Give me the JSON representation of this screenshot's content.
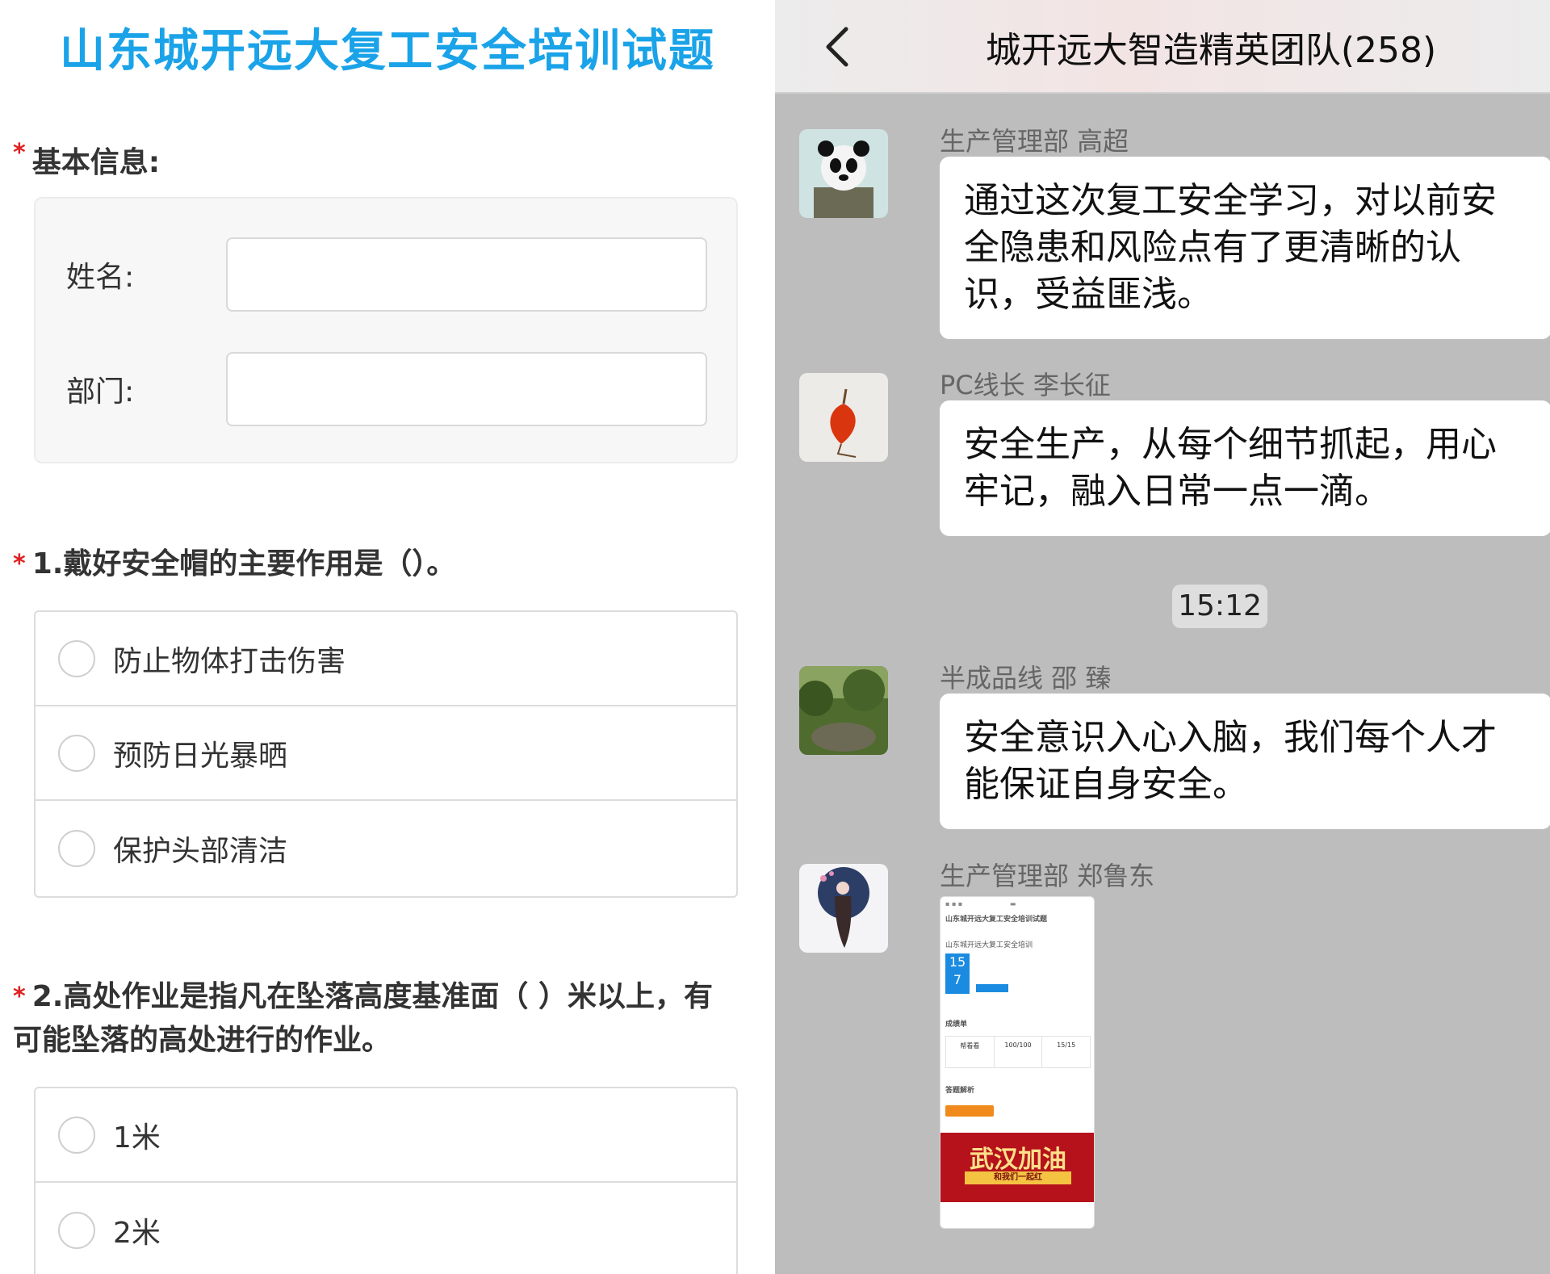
{
  "quiz": {
    "title": "山东城开远大复工安全培训试题",
    "basic_info": {
      "required_mark": "*",
      "label": "基本信息:",
      "name_label": "姓名:",
      "name_value": "",
      "dept_label": "部门:",
      "dept_value": ""
    },
    "questions": [
      {
        "required_mark": "*",
        "text": "1.戴好安全帽的主要作用是（）。",
        "options": [
          "防止物体打击伤害",
          "预防日光暴晒",
          "保护头部清洁"
        ]
      },
      {
        "required_mark": "*",
        "text": "2.高处作业是指凡在坠落高度基准面（ ）米以上，有可能坠落的高处进行的作业。",
        "options": [
          "1米",
          "2米"
        ]
      }
    ]
  },
  "chat": {
    "title": "城开远大智造精英团队(258)",
    "time_divider": "15:12",
    "messages": [
      {
        "sender": "生产管理部  高超",
        "text": "通过这次复工安全学习，对以前安全隐患和风险点有了更清晰的认识，受益匪浅。",
        "avatar": "panda-avatar"
      },
      {
        "sender": "PC线长  李长征",
        "text": "安全生产，从每个细节抓起，用心牢记，融入日常一点一滴。",
        "avatar": "lantern-flower-avatar"
      },
      {
        "sender": "半成品线  邵 臻",
        "text": "安全意识入心入脑，我们每个人才能保证自身安全。",
        "avatar": "forest-avatar"
      },
      {
        "sender": "生产管理部  郑鲁东",
        "avatar": "painting-avatar"
      }
    ],
    "thumbnail": {
      "title": "山东城开远大复工安全培训试题",
      "heading": "山东城开远大复工安全培训",
      "score_day": "15",
      "score_month": "7",
      "row_label": "成绩单",
      "cells": [
        "帮看看",
        "100/100",
        "15/15"
      ],
      "analysis_label": "答题解析",
      "banner_big": "武汉加油",
      "banner_sub": "和我们一起红"
    },
    "colors": {
      "quiz_title": "#1aa3e8",
      "required": "#e02020",
      "chat_bg": "#bdbdbd",
      "banner": "#b5121b"
    }
  }
}
